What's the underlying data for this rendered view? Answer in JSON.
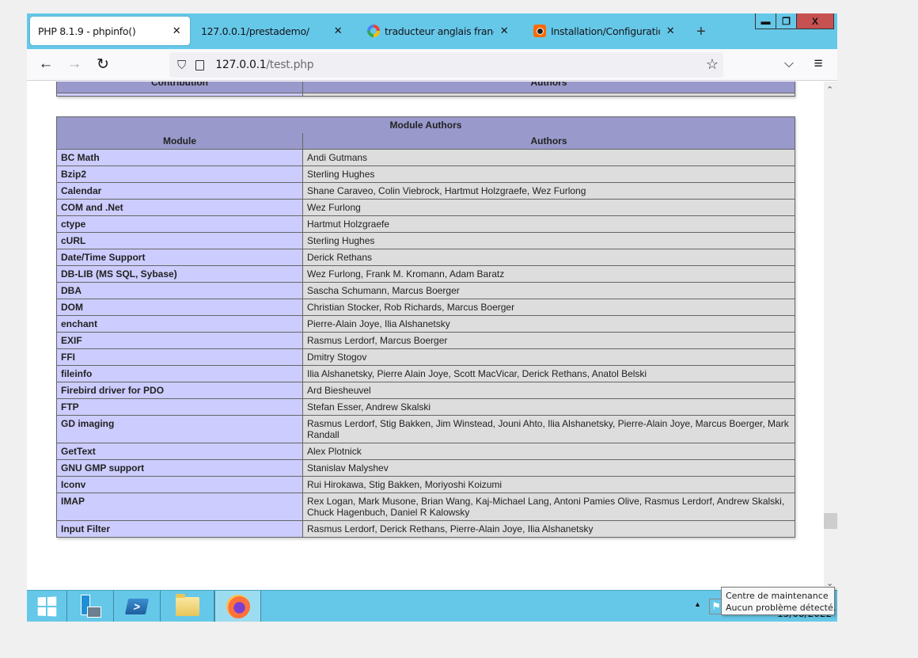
{
  "browser": {
    "tabs": [
      {
        "label": "PHP 8.1.9 - phpinfo()",
        "favicon": "none",
        "active": true
      },
      {
        "label": "127.0.0.1/prestademo/",
        "favicon": "none",
        "active": false
      },
      {
        "label": "traducteur anglais francais - I",
        "favicon": "google-icon",
        "active": false
      },
      {
        "label": "Installation/Configuration et",
        "favicon": "camera-icon",
        "active": false
      }
    ],
    "tab_close_glyph": "✕",
    "new_tab_glyph": "+",
    "window_controls": {
      "minimize": "▬",
      "restore": "❐",
      "close": "X"
    },
    "nav": {
      "back": "←",
      "forward": "→",
      "reload": "↻"
    },
    "url": {
      "host": "127.0.0.1",
      "path": "/test.php"
    },
    "bookmark_glyph": "☆",
    "pocket_glyph": "⌵",
    "menu_glyph": "≡"
  },
  "contribution_table": {
    "headers": [
      "Contribution",
      "Authors"
    ]
  },
  "module_authors": {
    "title": "Module Authors",
    "headers": [
      "Module",
      "Authors"
    ],
    "rows": [
      {
        "module": "BC Math",
        "authors": "Andi Gutmans"
      },
      {
        "module": "Bzip2",
        "authors": "Sterling Hughes"
      },
      {
        "module": "Calendar",
        "authors": "Shane Caraveo, Colin Viebrock, Hartmut Holzgraefe, Wez Furlong"
      },
      {
        "module": "COM and .Net",
        "authors": "Wez Furlong"
      },
      {
        "module": "ctype",
        "authors": "Hartmut Holzgraefe"
      },
      {
        "module": "cURL",
        "authors": "Sterling Hughes"
      },
      {
        "module": "Date/Time Support",
        "authors": "Derick Rethans"
      },
      {
        "module": "DB-LIB (MS SQL, Sybase)",
        "authors": "Wez Furlong, Frank M. Kromann, Adam Baratz"
      },
      {
        "module": "DBA",
        "authors": "Sascha Schumann, Marcus Boerger"
      },
      {
        "module": "DOM",
        "authors": "Christian Stocker, Rob Richards, Marcus Boerger"
      },
      {
        "module": "enchant",
        "authors": "Pierre-Alain Joye, Ilia Alshanetsky"
      },
      {
        "module": "EXIF",
        "authors": "Rasmus Lerdorf, Marcus Boerger"
      },
      {
        "module": "FFI",
        "authors": "Dmitry Stogov"
      },
      {
        "module": "fileinfo",
        "authors": "Ilia Alshanetsky, Pierre Alain Joye, Scott MacVicar, Derick Rethans, Anatol Belski"
      },
      {
        "module": "Firebird driver for PDO",
        "authors": "Ard Biesheuvel"
      },
      {
        "module": "FTP",
        "authors": "Stefan Esser, Andrew Skalski"
      },
      {
        "module": "GD imaging",
        "authors": "Rasmus Lerdorf, Stig Bakken, Jim Winstead, Jouni Ahto, Ilia Alshanetsky, Pierre-Alain Joye, Marcus Boerger, Mark Randall"
      },
      {
        "module": "GetText",
        "authors": "Alex Plotnick"
      },
      {
        "module": "GNU GMP support",
        "authors": "Stanislav Malyshev"
      },
      {
        "module": "Iconv",
        "authors": "Rui Hirokawa, Stig Bakken, Moriyoshi Koizumi"
      },
      {
        "module": "IMAP",
        "authors": "Rex Logan, Mark Musone, Brian Wang, Kaj-Michael Lang, Antoni Pamies Olive, Rasmus Lerdorf, Andrew Skalski, Chuck Hagenbuch, Daniel R Kalowsky"
      },
      {
        "module": "Input Filter",
        "authors": "Rasmus Lerdorf, Derick Rethans, Pierre-Alain Joye, Ilia Alshanetsky"
      }
    ]
  },
  "scrollbar": {
    "up": "⌃",
    "down": "⌄",
    "position_fraction": 0.88
  },
  "taskbar": {
    "items": [
      {
        "name": "start-button",
        "icon": "windows-logo-icon"
      },
      {
        "name": "server-manager",
        "icon": "server-manager-icon"
      },
      {
        "name": "powershell",
        "icon": "powershell-icon",
        "glyph": ">_"
      },
      {
        "name": "file-explorer",
        "icon": "folder-icon"
      },
      {
        "name": "firefox",
        "icon": "firefox-icon",
        "active": true
      }
    ],
    "tray_arrow": "▲",
    "tray_flag": "⚑",
    "clock_date": "15/08/2022"
  },
  "tooltip": {
    "line1": "Centre de maintenance",
    "line2": "Aucun problème détecté."
  }
}
